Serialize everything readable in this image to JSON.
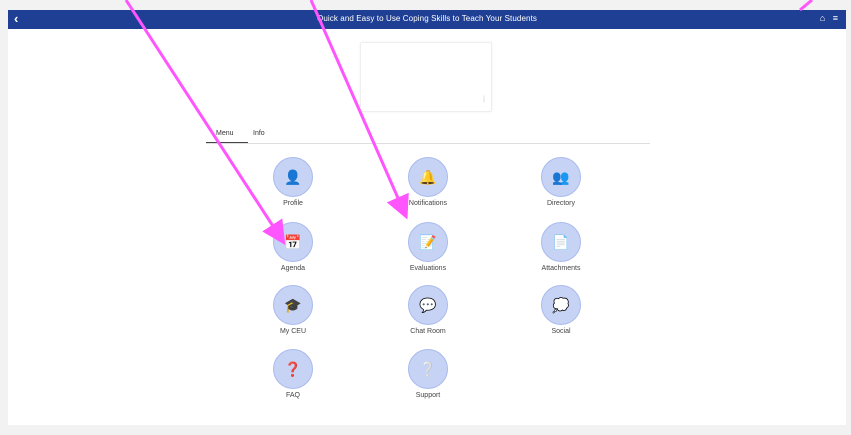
{
  "header": {
    "back_label": "‹",
    "title": "Quick and Easy to Use Coping Skills to Teach Your Students",
    "home_glyph": "⌂",
    "menu_glyph": "≡"
  },
  "tabs": [
    {
      "label": "Menu",
      "active": true
    },
    {
      "label": "Info",
      "active": false
    }
  ],
  "tiles": [
    {
      "label": "Profile",
      "icon": "user-search-icon",
      "glyph": "👤"
    },
    {
      "label": "Notifications",
      "icon": "notifications-icon",
      "glyph": "🔔"
    },
    {
      "label": "Directory",
      "icon": "directory-icon",
      "glyph": "👥"
    },
    {
      "label": "Agenda",
      "icon": "calendar-icon",
      "glyph": "📅"
    },
    {
      "label": "Evaluations",
      "icon": "evaluations-icon",
      "glyph": "📝"
    },
    {
      "label": "Attachments",
      "icon": "attachments-icon",
      "glyph": "📄"
    },
    {
      "label": "My CEU",
      "icon": "certificate-icon",
      "glyph": "🎓"
    },
    {
      "label": "Chat Room",
      "icon": "chat-icon",
      "glyph": "💬"
    },
    {
      "label": "Social",
      "icon": "social-icon",
      "glyph": "💭"
    },
    {
      "label": "FAQ",
      "icon": "question-icon",
      "glyph": "❓"
    },
    {
      "label": "Support",
      "icon": "support-icon",
      "glyph": "❔"
    }
  ],
  "colors": {
    "header_bg": "#1f3f94",
    "tile_bg": "#c7d3f5",
    "annotation_arrow": "#ff55ff"
  }
}
